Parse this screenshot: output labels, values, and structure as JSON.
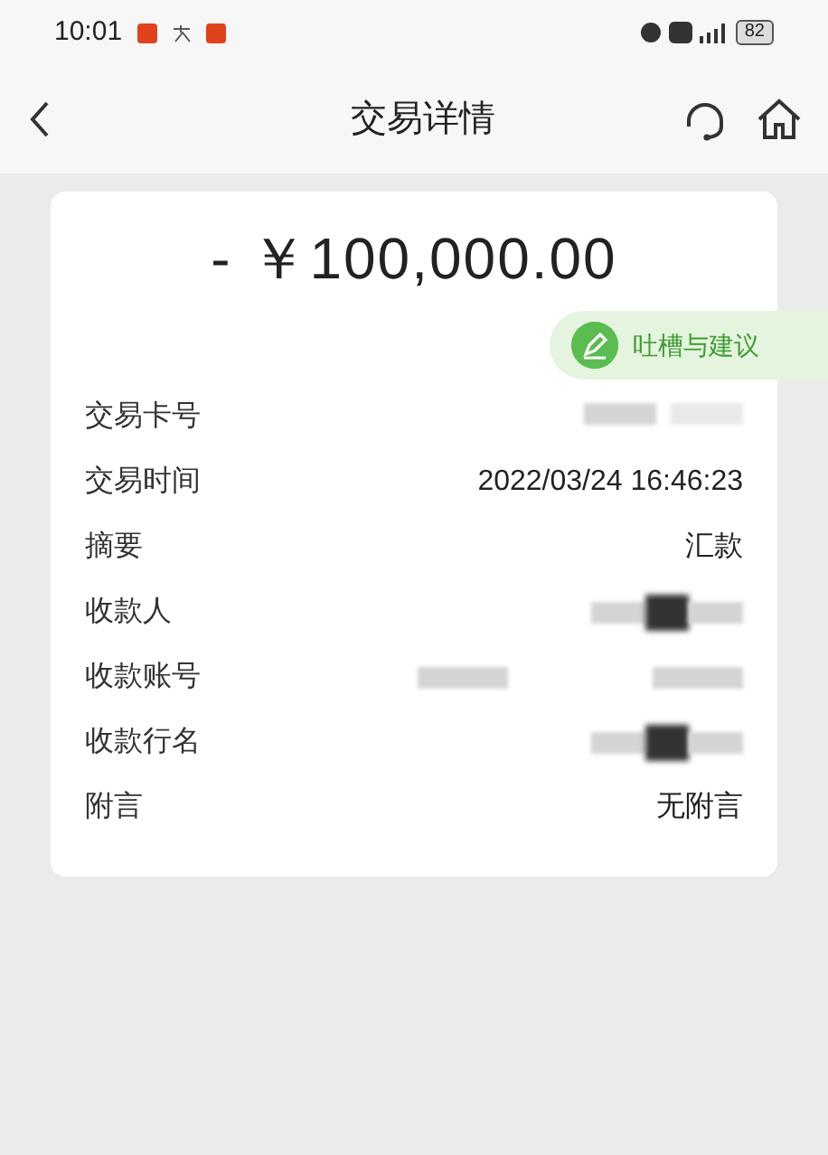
{
  "status_bar": {
    "time": "10:01",
    "battery": "82"
  },
  "header": {
    "title": "交易详情"
  },
  "amount": "- ￥100,000.00",
  "feedback": {
    "label": "吐槽与建议"
  },
  "rows": [
    {
      "label": "交易卡号",
      "kind": "redacted"
    },
    {
      "label": "交易时间",
      "kind": "text",
      "value": "2022/03/24 16:46:23"
    },
    {
      "label": "摘要",
      "kind": "text",
      "value": "汇款"
    },
    {
      "label": "收款人",
      "kind": "redacted_dark"
    },
    {
      "label": "收款账号",
      "kind": "redacted_wide"
    },
    {
      "label": "收款行名",
      "kind": "redacted_dark"
    },
    {
      "label": "附言",
      "kind": "text",
      "value": "无附言"
    }
  ]
}
